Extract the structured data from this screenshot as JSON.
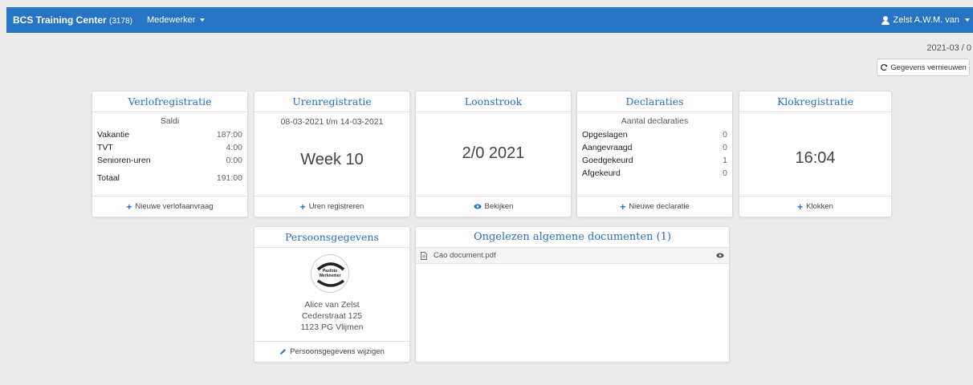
{
  "navbar": {
    "brand": "BCS Training Center",
    "brand_code": "(3178)",
    "menu_label": "Medewerker",
    "user_label": "Zelst A.W.M. van"
  },
  "header": {
    "date_label": "2021-03 / 0",
    "refresh_label": "Gegevens vernieuwen"
  },
  "verlof": {
    "title": "Verlofregistratie",
    "subtitle": "Saldi",
    "rows": [
      {
        "label": "Vakantie",
        "value": "187:00"
      },
      {
        "label": "TVT",
        "value": "4:00"
      },
      {
        "label": "Senioren-uren",
        "value": "0:00"
      }
    ],
    "total_label": "Totaal",
    "total_value": "191:00",
    "action": "Nieuwe verlofaanvraag"
  },
  "uren": {
    "title": "Urenregistratie",
    "period": "08-03-2021 t/m 14-03-2021",
    "week": "Week 10",
    "action": "Uren registreren"
  },
  "loonstrook": {
    "title": "Loonstrook",
    "value": "2/0 2021",
    "action": "Bekijken"
  },
  "declaraties": {
    "title": "Declaraties",
    "subtitle": "Aantal declaraties",
    "rows": [
      {
        "label": "Opgeslagen",
        "value": "0"
      },
      {
        "label": "Aangevraagd",
        "value": "0"
      },
      {
        "label": "Goedgekeurd",
        "value": "1"
      },
      {
        "label": "Afgekeurd",
        "value": "0"
      }
    ],
    "action": "Nieuwe declaratie"
  },
  "klok": {
    "title": "Klokregistratie",
    "time": "16:04",
    "action": "Klokken"
  },
  "persoon": {
    "title": "Persoonsgegevens",
    "photo_line1": "Pasfoto",
    "photo_line2": "Werknemer",
    "name": "Alice van Zelst",
    "street": "Cederstraat 125",
    "city": "1123 PG Vlijmen",
    "action": "Persoonsgegevens wijzigen"
  },
  "documenten": {
    "title": "Ongelezen algemene documenten (1)",
    "items": [
      {
        "name": "Cao document.pdf"
      }
    ]
  },
  "colors": {
    "brand_blue": "#2773c4",
    "title_blue": "#2a6ebd",
    "background": "#ececec"
  }
}
